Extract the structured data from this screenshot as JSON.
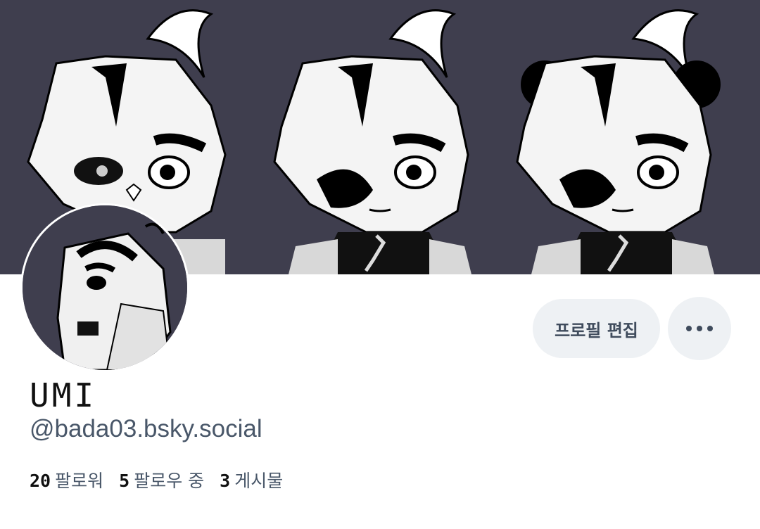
{
  "profile": {
    "display_name": "UMI",
    "handle": "@bada03.bsky.social"
  },
  "actions": {
    "edit_profile_label": "프로필 편집",
    "more_icon": "ellipsis-icon"
  },
  "stats": {
    "followers_count": "20",
    "followers_label": "팔로워",
    "following_count": "5",
    "following_label": "팔로우 중",
    "posts_count": "3",
    "posts_label": "게시물"
  },
  "colors": {
    "banner_bg": "#3f3e4e",
    "button_bg": "#eef1f4",
    "text_secondary": "#495769"
  }
}
